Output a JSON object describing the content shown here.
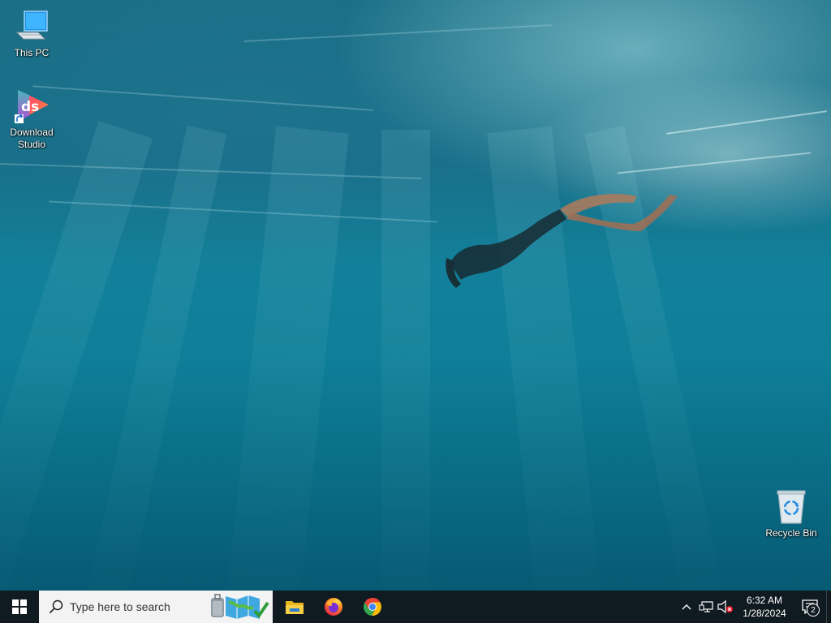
{
  "desktop": {
    "icons": [
      {
        "label": "This PC",
        "icon": "this-pc-icon"
      },
      {
        "label": "Download\nStudio",
        "icon": "download-studio-icon"
      },
      {
        "label": "Recycle Bin",
        "icon": "recycle-bin-icon"
      }
    ]
  },
  "taskbar": {
    "start_icon": "windows-logo-icon",
    "search": {
      "placeholder": "Type here to search"
    },
    "pinned_apps": [
      {
        "name": "File Explorer",
        "icon": "file-explorer-icon"
      },
      {
        "name": "Firefox",
        "icon": "firefox-icon"
      },
      {
        "name": "Google Chrome",
        "icon": "chrome-icon"
      }
    ],
    "tray": {
      "time": "6:32 AM",
      "date": "1/28/2024",
      "notification_count": "2"
    }
  },
  "colors": {
    "taskbar_bg": "#101a21",
    "search_bg": "#f3f3f3",
    "water": "#0f7f99"
  }
}
